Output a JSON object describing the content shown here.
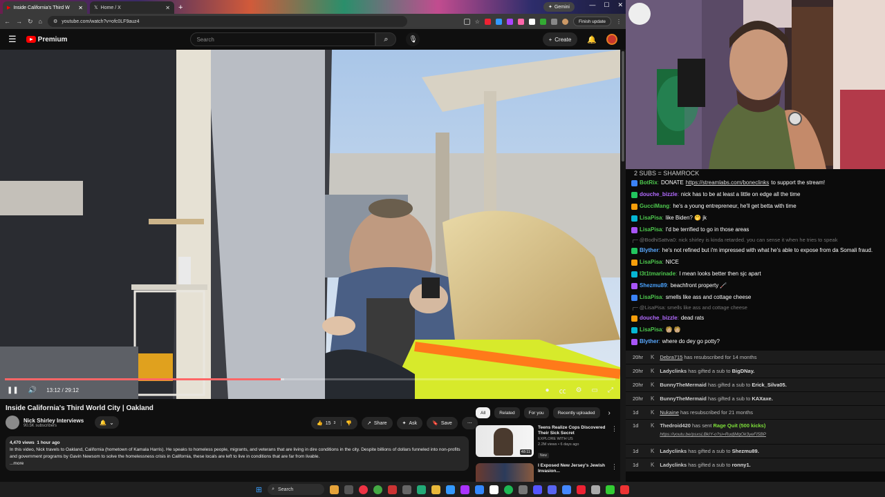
{
  "browser": {
    "tabs": [
      {
        "title": "Inside California's Third W",
        "active": true
      },
      {
        "title": "Home / X",
        "active": false
      }
    ],
    "gemini_label": "Gemini",
    "url": "youtube.com/watch?v=ofc0LF9auz4",
    "finish_update": "Finish update"
  },
  "youtube": {
    "logo_text": "Premium",
    "search_placeholder": "Search",
    "create_label": "Create",
    "player": {
      "time_current": "13:12",
      "time_sep": "/",
      "time_total": "29:12",
      "progress_fraction": 0.452
    },
    "video": {
      "title": "Inside California's Third World City | Oakland",
      "channel": "Nick Shirley Interviews",
      "subscribers": "90.5K subscribers",
      "likes": "15",
      "like_suffix": "3",
      "share": "Share",
      "ask": "Ask",
      "save": "Save",
      "views": "4,470 views",
      "age": "1 hour ago",
      "description": "In this video, Nick travels to Oakland, California (hometown of Kamala Harris). He speaks to homeless people, migrants, and veterans that are living in dire conditions in the city. Despite billions of dollars funneled into non-profits and government programs by Gavin Newsom to solve the homelessness crisis in California, these locals are left to live in conditions that are far from livable.",
      "more": "...more"
    },
    "chips": [
      "All",
      "Related",
      "For you",
      "Recently uploaded"
    ],
    "recommendations": [
      {
        "title": "Teens Realize Cops Discovered Their Sick Secret",
        "channel": "EXPLORE WITH US",
        "meta": "2.2M views • 6 days ago",
        "badge": "New",
        "duration": "48:11"
      },
      {
        "title": "I Exposed New Jersey's Jewish Invasion...",
        "channel": "",
        "meta": "",
        "badge": "",
        "duration": ""
      }
    ]
  },
  "chat": {
    "banner": "2 SUBS = SHAMROCK",
    "messages": [
      {
        "user": "BotRix",
        "text": "DONATE",
        "link": "https://streamlabs.com/boneclinks",
        "after": "to support the stream!",
        "color": "#4ec94e"
      },
      {
        "user": "douche_bizzle",
        "text": "nick has to be at least a little on edge all the time",
        "color": "#b36bff"
      },
      {
        "user": "GucciMang",
        "text": "he's a young entrepreneur, he'll get betta with time",
        "color": "#4ec94e"
      },
      {
        "user": "LisaPisa",
        "text": "like Biden? 🤭 jk",
        "color": "#4ec94e"
      },
      {
        "user": "LisaPisa",
        "text": "I'd be terrified to go in those areas",
        "color": "#4ec94e"
      }
    ],
    "reply1": "@BodhiSattva0: nick shirley is kinda retarded. you can sense it when he tries to speak",
    "messages2": [
      {
        "user": "Blyther",
        "text": "he's not refined but i'm impressed with what he's able to expose from da Somali fraud.",
        "color": "#5aa9ff"
      },
      {
        "user": "LisaPisa",
        "text": "NICE",
        "color": "#4ec94e"
      },
      {
        "user": "l3t1tmarinade",
        "text": "I mean looks better then sjc apart",
        "color": "#4ec94e"
      },
      {
        "user": "Shezmu89",
        "text": "beachfront property 🦯",
        "color": "#4aa3ff"
      },
      {
        "user": "LisaPisa",
        "text": "smells like ass and cottage cheese",
        "color": "#4ec94e"
      }
    ],
    "reply2": "@LisaPisa: smells like ass and cottage cheese",
    "messages3": [
      {
        "user": "douche_bizzle",
        "text": "dead rats",
        "color": "#b36bff"
      },
      {
        "user": "LisaPisa",
        "text": "🧑🏼 🧑🏼",
        "color": "#4ec94e"
      },
      {
        "user": "Blyther",
        "text": "where do dey go potty?",
        "color": "#5aa9ff"
      }
    ],
    "events": [
      {
        "time": "20hr",
        "name": "Debra715",
        "text": "has resubscribed for 14 months",
        "underline": true
      },
      {
        "time": "20hr",
        "name": "Ladyclinks",
        "text": "has gifted a sub to",
        "target": "BigDNay."
      },
      {
        "time": "20hr",
        "name": "BunnyTheMermaid",
        "text": "has gifted a sub to",
        "target": "Erick_Silva05."
      },
      {
        "time": "20hr",
        "name": "BunnyTheMermaid",
        "text": "has gifted a sub to",
        "target": "KAXaxe."
      },
      {
        "time": "1d",
        "name": "Nukaine",
        "text": "has resubscribed for 21 months",
        "underline": true
      },
      {
        "time": "1d",
        "name": "Thedroid420",
        "text": "has sent",
        "target": "Rage Quit (500 kicks)",
        "link": "https://youtu.be/psxsLBkIY-o?si=RudjMqOk3yeFI5BP"
      },
      {
        "time": "1d",
        "name": "Ladyclinks",
        "text": "has gifted a sub to",
        "target": "Shezmu89."
      },
      {
        "time": "1d",
        "name": "Ladyclinks",
        "text": "has gifted a sub to",
        "target": "ronny1."
      }
    ]
  },
  "taskbar": {
    "search": "Search"
  }
}
